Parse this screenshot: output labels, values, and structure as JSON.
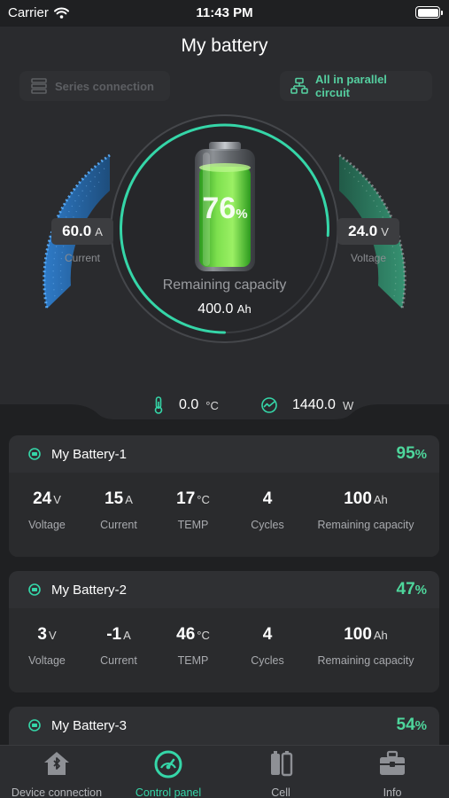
{
  "status_bar": {
    "carrier": "Carrier",
    "time": "11:43 PM"
  },
  "header": {
    "title": "My battery"
  },
  "modes": {
    "series_label": "Series connection",
    "parallel_label": "All in parallel circuit"
  },
  "gauge": {
    "current_value": "60.0",
    "current_unit": "A",
    "current_label": "Current",
    "voltage_value": "24.0",
    "voltage_unit": "V",
    "voltage_label": "Voltage",
    "percent": "76",
    "percent_sign": "%",
    "capacity_label": "Remaining capacity",
    "capacity_value": "400.0",
    "capacity_unit": "Ah",
    "ring_fraction": 0.76
  },
  "info": {
    "temp_value": "0.0",
    "temp_unit": "°C",
    "power_value": "1440.0",
    "power_unit": "W"
  },
  "batteries": [
    {
      "name": "My Battery-1",
      "percent": "95",
      "voltage": "24",
      "current": "15",
      "temp": "17",
      "cycles": "4",
      "remaining": "100"
    },
    {
      "name": "My Battery-2",
      "percent": "47",
      "voltage": "3",
      "current": "-1",
      "temp": "46",
      "cycles": "4",
      "remaining": "100"
    },
    {
      "name": "My Battery-3",
      "percent": "54"
    }
  ],
  "metric_units": {
    "voltage": "V",
    "current": "A",
    "temp": "°C",
    "remaining": "Ah",
    "percent_sign": "%"
  },
  "metric_labels": {
    "voltage": "Voltage",
    "current": "Current",
    "temp": "TEMP",
    "cycles": "Cycles",
    "remaining": "Remaining capacity"
  },
  "tabs": [
    {
      "label": "Device connection",
      "icon": "home-bluetooth-icon"
    },
    {
      "label": "Control panel",
      "icon": "speedometer-icon"
    },
    {
      "label": "Cell",
      "icon": "battery-cells-icon"
    },
    {
      "label": "Info",
      "icon": "toolbox-icon"
    }
  ],
  "colors": {
    "accent": "#35d6a8",
    "percent_green": "#4ed69c",
    "current_arc": "#3d8fd8",
    "voltage_arc": "#3fb58c",
    "background": "#1f2022"
  }
}
